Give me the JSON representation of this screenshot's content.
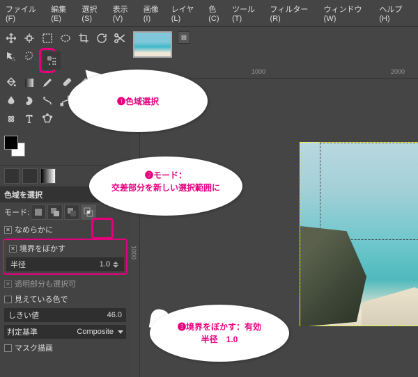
{
  "menu": [
    "ファイル(F)",
    "編集(E)",
    "選択(S)",
    "表示(V)",
    "画像(I)",
    "レイヤ(L)",
    "色(C)",
    "ツール(T)",
    "フィルター(R)",
    "ウィンドウ(W)",
    "ヘルプ(H)"
  ],
  "ruler": {
    "r1": "1000",
    "r2": "2000",
    "rv": "1000"
  },
  "opt": {
    "title": "色域を選択",
    "mode_label": "モード:",
    "smooth": "なめらかに",
    "feather": "境界をぼかす",
    "radius_label": "半径",
    "radius_value": "1.0",
    "transp": "透明部分も選択可",
    "visible": "見えている色で",
    "thresh_label": "しきい値",
    "thresh_value": "46.0",
    "criteria_label": "判定基準",
    "criteria_value": "Composite",
    "mask": "マスク描画"
  },
  "annot": {
    "a1": "❶色域選択",
    "a2_l1": "❷モード：",
    "a2_l2": "交差部分を新しい選択範囲に",
    "a3_l1": "❸境界をぼかす：有効",
    "a3_l2": "半径　1.0"
  }
}
